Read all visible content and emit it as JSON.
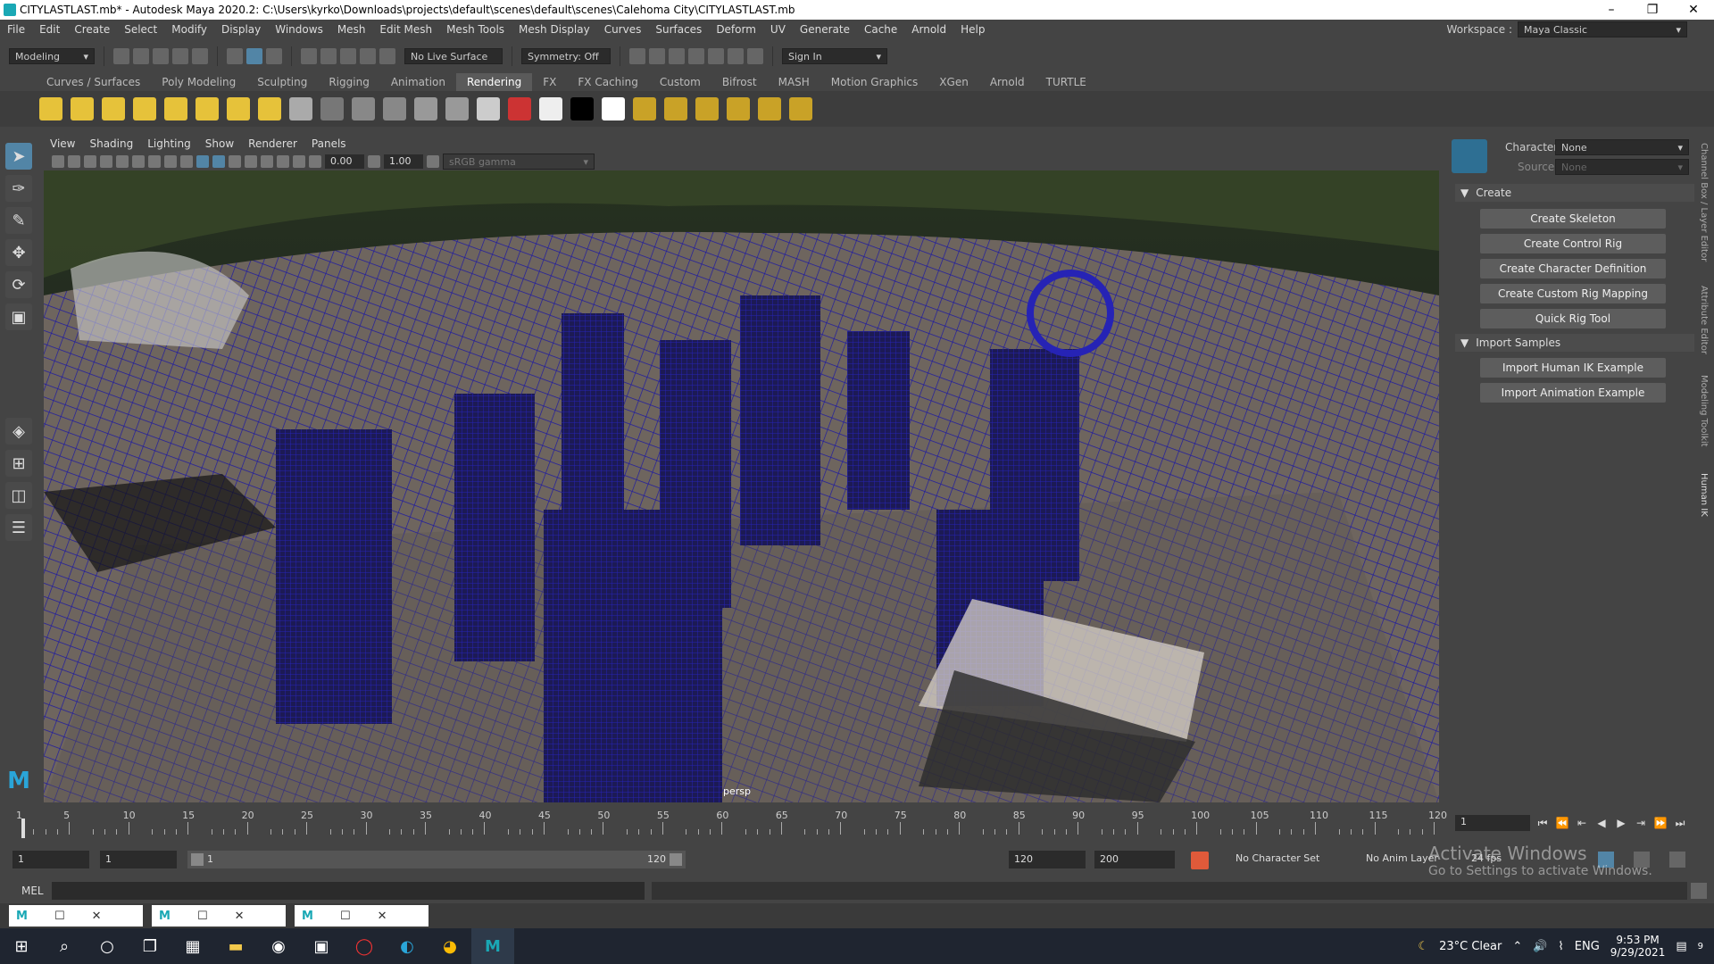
{
  "window": {
    "title": "CITYLASTLAST.mb* - Autodesk Maya 2020.2: C:\\Users\\kyrko\\Downloads\\projects\\default\\scenes\\default\\scenes\\Calehoma City\\CITYLASTLAST.mb",
    "minimize": "–",
    "restore": "❐",
    "close": "✕"
  },
  "menubar": {
    "items": [
      "File",
      "Edit",
      "Create",
      "Select",
      "Modify",
      "Display",
      "Windows",
      "Mesh",
      "Edit Mesh",
      "Mesh Tools",
      "Mesh Display",
      "Curves",
      "Surfaces",
      "Deform",
      "UV",
      "Generate",
      "Cache",
      "Arnold",
      "Help"
    ],
    "workspace_label": "Workspace :",
    "workspace_value": "Maya Classic"
  },
  "statusline": {
    "mode": "Modeling",
    "live_surface": "No Live Surface",
    "symmetry": "Symmetry: Off",
    "sign_in": "Sign In"
  },
  "shelf_tabs": [
    "Curves / Surfaces",
    "Poly Modeling",
    "Sculpting",
    "Rigging",
    "Animation",
    "Rendering",
    "FX",
    "FX Caching",
    "Custom",
    "Bifrost",
    "MASH",
    "Motion Graphics",
    "XGen",
    "Arnold",
    "TURTLE"
  ],
  "active_shelf_tab": "Rendering",
  "shelf_colors": [
    "#e6c23a",
    "#e6c23a",
    "#e6c23a",
    "#e6c23a",
    "#e6c23a",
    "#e6c23a",
    "#e6c23a",
    "#e6c23a",
    "#aaaaaa",
    "#777777",
    "#888888",
    "#888888",
    "#999999",
    "#999999",
    "#cccccc",
    "#cc3333",
    "#eeeeee",
    "#000000",
    "#ffffff",
    "#c9a227",
    "#c9a227",
    "#c9a227",
    "#c9a227",
    "#c9a227",
    "#c9a227"
  ],
  "panel_menu": [
    "View",
    "Shading",
    "Lighting",
    "Show",
    "Renderer",
    "Panels"
  ],
  "panel_toolbar": {
    "exposure": "0.00",
    "gamma": "1.00",
    "color_space": "sRGB gamma"
  },
  "viewport": {
    "camera": "persp"
  },
  "right_panel": {
    "character_label": "Character:",
    "character_value": "None",
    "source_label": "Source:",
    "source_value": "None",
    "create_section": "Create",
    "create_buttons": [
      "Create Skeleton",
      "Create Control Rig",
      "Create Character Definition",
      "Create Custom Rig Mapping",
      "Quick Rig Tool"
    ],
    "import_section": "Import Samples",
    "import_buttons": [
      "Import Human IK Example",
      "Import Animation Example"
    ]
  },
  "side_tabs": [
    "Channel Box / Layer Editor",
    "Attribute Editor",
    "Modeling Toolkit",
    "Human IK"
  ],
  "timeline": {
    "ticks": [
      "1",
      "5",
      "10",
      "15",
      "20",
      "25",
      "30",
      "35",
      "40",
      "45",
      "50",
      "55",
      "60",
      "65",
      "70",
      "75",
      "80",
      "85",
      "90",
      "95",
      "100",
      "105",
      "110",
      "115",
      "120"
    ],
    "current_frame": "1"
  },
  "range": {
    "start": "1",
    "playback_start": "1",
    "range_start_label": "1",
    "range_end_label": "120",
    "playback_end": "120",
    "end": "200",
    "character_set": "No Character Set",
    "anim_layer": "No Anim Layer",
    "fps": "24 fps"
  },
  "command_line": {
    "lang": "MEL"
  },
  "watermark": {
    "line1": "Activate Windows",
    "line2": "Go to Settings to activate Windows."
  },
  "taskbar": {
    "weather": "23°C  Clear",
    "lang": "ENG",
    "time": "9:53 PM",
    "date": "9/29/2021",
    "notifications": "9"
  }
}
